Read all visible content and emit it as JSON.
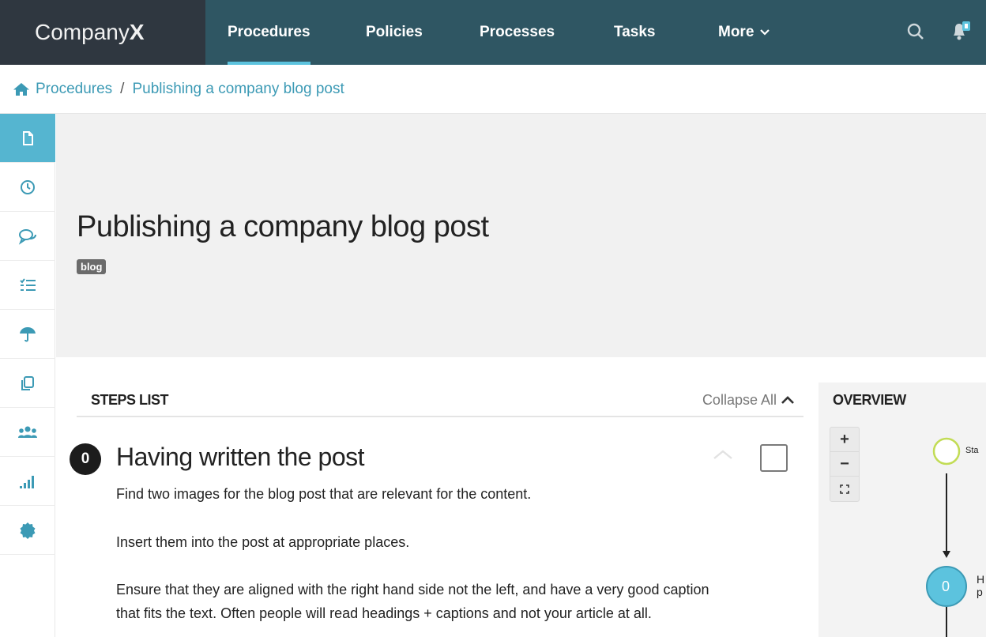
{
  "brand": {
    "name_part1": "Company",
    "name_part2": "X"
  },
  "nav": {
    "items": [
      {
        "label": "Procedures",
        "active": true
      },
      {
        "label": "Policies"
      },
      {
        "label": "Processes"
      },
      {
        "label": "Tasks"
      },
      {
        "label": "More"
      }
    ],
    "icons": [
      "search-icon",
      "bell-notification-icon"
    ]
  },
  "breadcrumb": {
    "root": "Procedures",
    "separator": "/",
    "current": "Publishing a company blog post"
  },
  "sidebar": {
    "items": [
      {
        "icon": "document-icon",
        "active": true
      },
      {
        "icon": "clock-icon"
      },
      {
        "icon": "comments-icon"
      },
      {
        "icon": "checklist-icon"
      },
      {
        "icon": "umbrella-icon"
      },
      {
        "icon": "copy-icon"
      },
      {
        "icon": "users-icon"
      },
      {
        "icon": "signal-bars-icon"
      },
      {
        "icon": "badge-icon"
      }
    ]
  },
  "page": {
    "title": "Publishing a company blog post",
    "tag": "blog"
  },
  "steps": {
    "header": "STEPS LIST",
    "collapse_label": "Collapse All",
    "items": [
      {
        "number": "0",
        "title": "Having written the post",
        "paragraphs": [
          "Find two images for the blog post that are relevant for the content.",
          "Insert them into the post at appropriate places.",
          "Ensure that they are aligned with the right hand side not the left, and have a very good caption",
          "that fits the text. Often people will read headings + captions and not your article at all."
        ]
      }
    ]
  },
  "overview": {
    "title": "OVERVIEW",
    "zoom": {
      "in": "+",
      "out": "−",
      "fit": "⛶"
    },
    "nodes": [
      {
        "label": "Sta"
      },
      {
        "number": "0",
        "label_line1": "H",
        "label_line2": "p"
      }
    ]
  },
  "colors": {
    "nav_bg": "#2f5663",
    "brand_bg": "#2f3740",
    "accent": "#5cc3de",
    "link": "#3c9ab5"
  }
}
